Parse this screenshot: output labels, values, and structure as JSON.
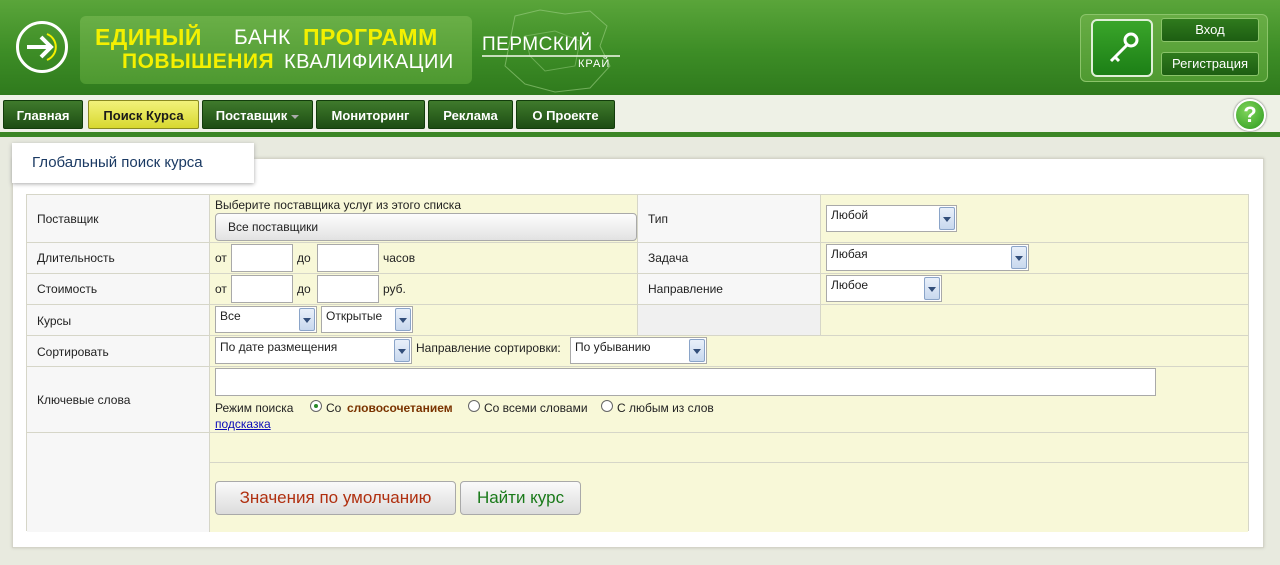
{
  "header": {
    "logo_line1_a": "ЕДИНЫЙ",
    "logo_line1_b": "БАНК",
    "logo_line1_c": "ПРОГРАММ",
    "logo_line2_a": "ПОВЫШЕНИЯ",
    "logo_line2_b": "КВАЛИФИКАЦИИ",
    "region": "ПЕРМСКИЙ",
    "region_sub": "КРАЙ",
    "login_label": "Вход",
    "register_label": "Регистрация"
  },
  "menu": {
    "items": [
      {
        "label": "Главная"
      },
      {
        "label": "Поиск Курса"
      },
      {
        "label": "Поставщик"
      },
      {
        "label": "Мониторинг"
      },
      {
        "label": "Реклама"
      },
      {
        "label": "О Проекте"
      }
    ],
    "help": "?"
  },
  "tab_title": "Глобальный поиск курса",
  "form": {
    "provider_label": "Поставщик",
    "provider_hint": "Выберите поставщика услуг из этого списка",
    "provider_button": "Все поставщики",
    "type_label": "Тип",
    "type_value": "Любой",
    "duration_label": "Длительность",
    "from": "от",
    "to": "до",
    "hours": "часов",
    "task_label": "Задача",
    "task_value": "Любая",
    "cost_label": "Стоимость",
    "rub": "руб.",
    "direction_label": "Направление",
    "direction_value": "Любое",
    "courses_label": "Курсы",
    "courses_value1": "Все",
    "courses_value2": "Открытые",
    "sort_label": "Сортировать",
    "sort_value": "По дате размещения",
    "sort_dir_label": "Направление сортировки:",
    "sort_dir_value": "По убыванию",
    "keywords_label": "Ключевые слова",
    "search_mode_label": "Режим поиска",
    "mode_phrase_a": "Со",
    "mode_phrase_b": "словосочетанием",
    "mode_all": "Со всеми словами",
    "mode_any": "С любым из слов",
    "hint_link": "подсказка",
    "reset_button": "Значения по умолчанию",
    "search_button": "Найти курс"
  },
  "colors": {
    "header_green": "#3d8d26",
    "accent_yellow": "#f4f000",
    "form_bg": "#f8f8d8",
    "reset_text": "#b03010",
    "search_text": "#1a7a1a"
  }
}
